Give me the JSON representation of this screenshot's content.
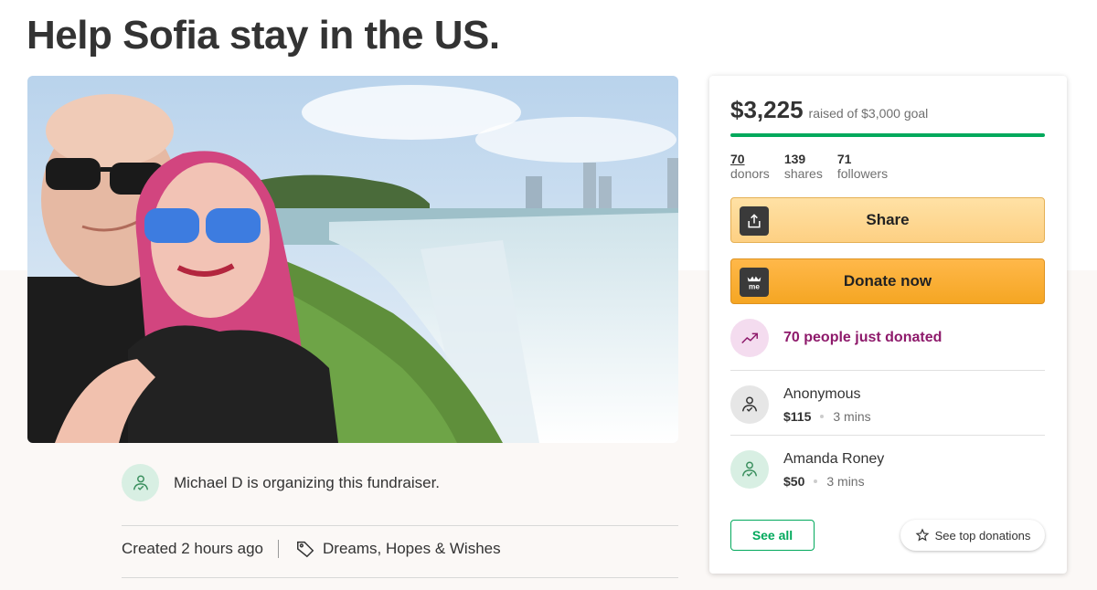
{
  "campaign": {
    "title": "Help Sofia stay in the US."
  },
  "organizer": {
    "text": "Michael D is organizing this fundraiser."
  },
  "meta": {
    "created": "Created 2 hours ago",
    "category": "Dreams, Hopes & Wishes"
  },
  "donation_card": {
    "raised": "$3,225",
    "goal_text": "raised of $3,000 goal",
    "progress_fraction": 1.0,
    "stats": [
      {
        "num": "70",
        "label": "donors"
      },
      {
        "num": "139",
        "label": "shares"
      },
      {
        "num": "71",
        "label": "followers"
      }
    ],
    "share_label": "Share",
    "donate_label": "Donate now",
    "trend_text": "70 people just donated",
    "donations": [
      {
        "name": "Anonymous",
        "amount": "$115",
        "time": "3 mins"
      },
      {
        "name": "Amanda Roney",
        "amount": "$50",
        "time": "3 mins"
      }
    ],
    "see_all_label": "See all",
    "see_top_label": "See top donations",
    "icon_logo_text": "me"
  },
  "colors": {
    "accent_green": "#02a95c",
    "trend_purple": "#8e1a6b",
    "donate_orange": "#f5a623",
    "share_yellow": "#fdd083"
  }
}
